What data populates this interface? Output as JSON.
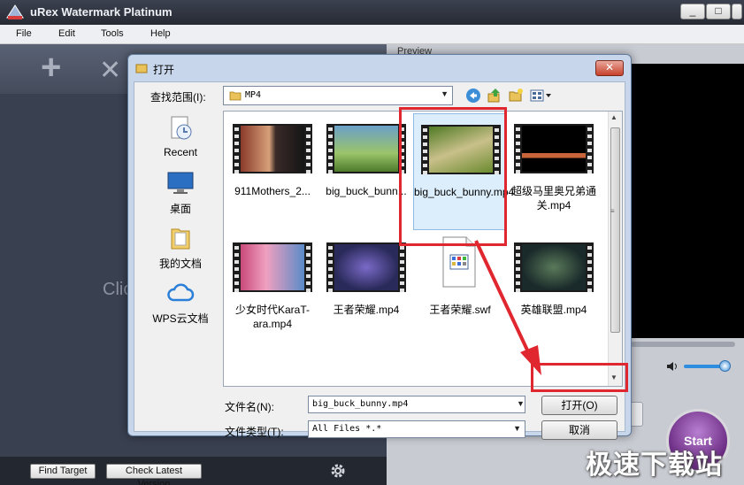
{
  "app": {
    "title": "uRex Watermark Platinum",
    "window_buttons": [
      "_",
      "□",
      "✕"
    ]
  },
  "menu": [
    "File",
    "Edit",
    "Tools",
    "Help"
  ],
  "left_panel": {
    "click_hint": "Clic"
  },
  "right_panel": {
    "preview_label": "Preview",
    "start_label": "Start"
  },
  "bottom_bar": {
    "find_target": "Find Target",
    "check_version": "Check Latest Version"
  },
  "dialog": {
    "title": "打开",
    "close": "✕",
    "lookin_label": "查找范围(I):",
    "lookin_value": "MP4",
    "places": [
      {
        "label": "Recent",
        "icon": "recent-places-icon"
      },
      {
        "label": "桌面",
        "icon": "desktop-icon"
      },
      {
        "label": "我的文档",
        "icon": "documents-folder-icon"
      },
      {
        "label": "WPS云文档",
        "icon": "wps-cloud-icon"
      }
    ],
    "files": [
      {
        "name": "911Mothers_2...",
        "selected": false
      },
      {
        "name": "big_buck_bunn...",
        "selected": false
      },
      {
        "name": "big_buck_bunny.mp4",
        "selected": true
      },
      {
        "name": "超级马里奥兄弟通关.mp4",
        "selected": false
      },
      {
        "name": "少女时代KaraT-ara.mp4",
        "selected": false
      },
      {
        "name": "王者荣耀.mp4",
        "selected": false
      },
      {
        "name": "王者荣耀.swf",
        "selected": false
      },
      {
        "name": "英雄联盟.mp4",
        "selected": false
      }
    ],
    "filename_label": "文件名(N):",
    "filename_value": "big_buck_bunny.mp4",
    "filetype_label": "文件类型(T):",
    "filetype_value": "All Files *.*",
    "open_button": "打开(O)",
    "cancel_button": "取消"
  },
  "watermark": "极速下载站",
  "colors": {
    "highlight": "#e0262e",
    "accent": "#2f8de0"
  }
}
